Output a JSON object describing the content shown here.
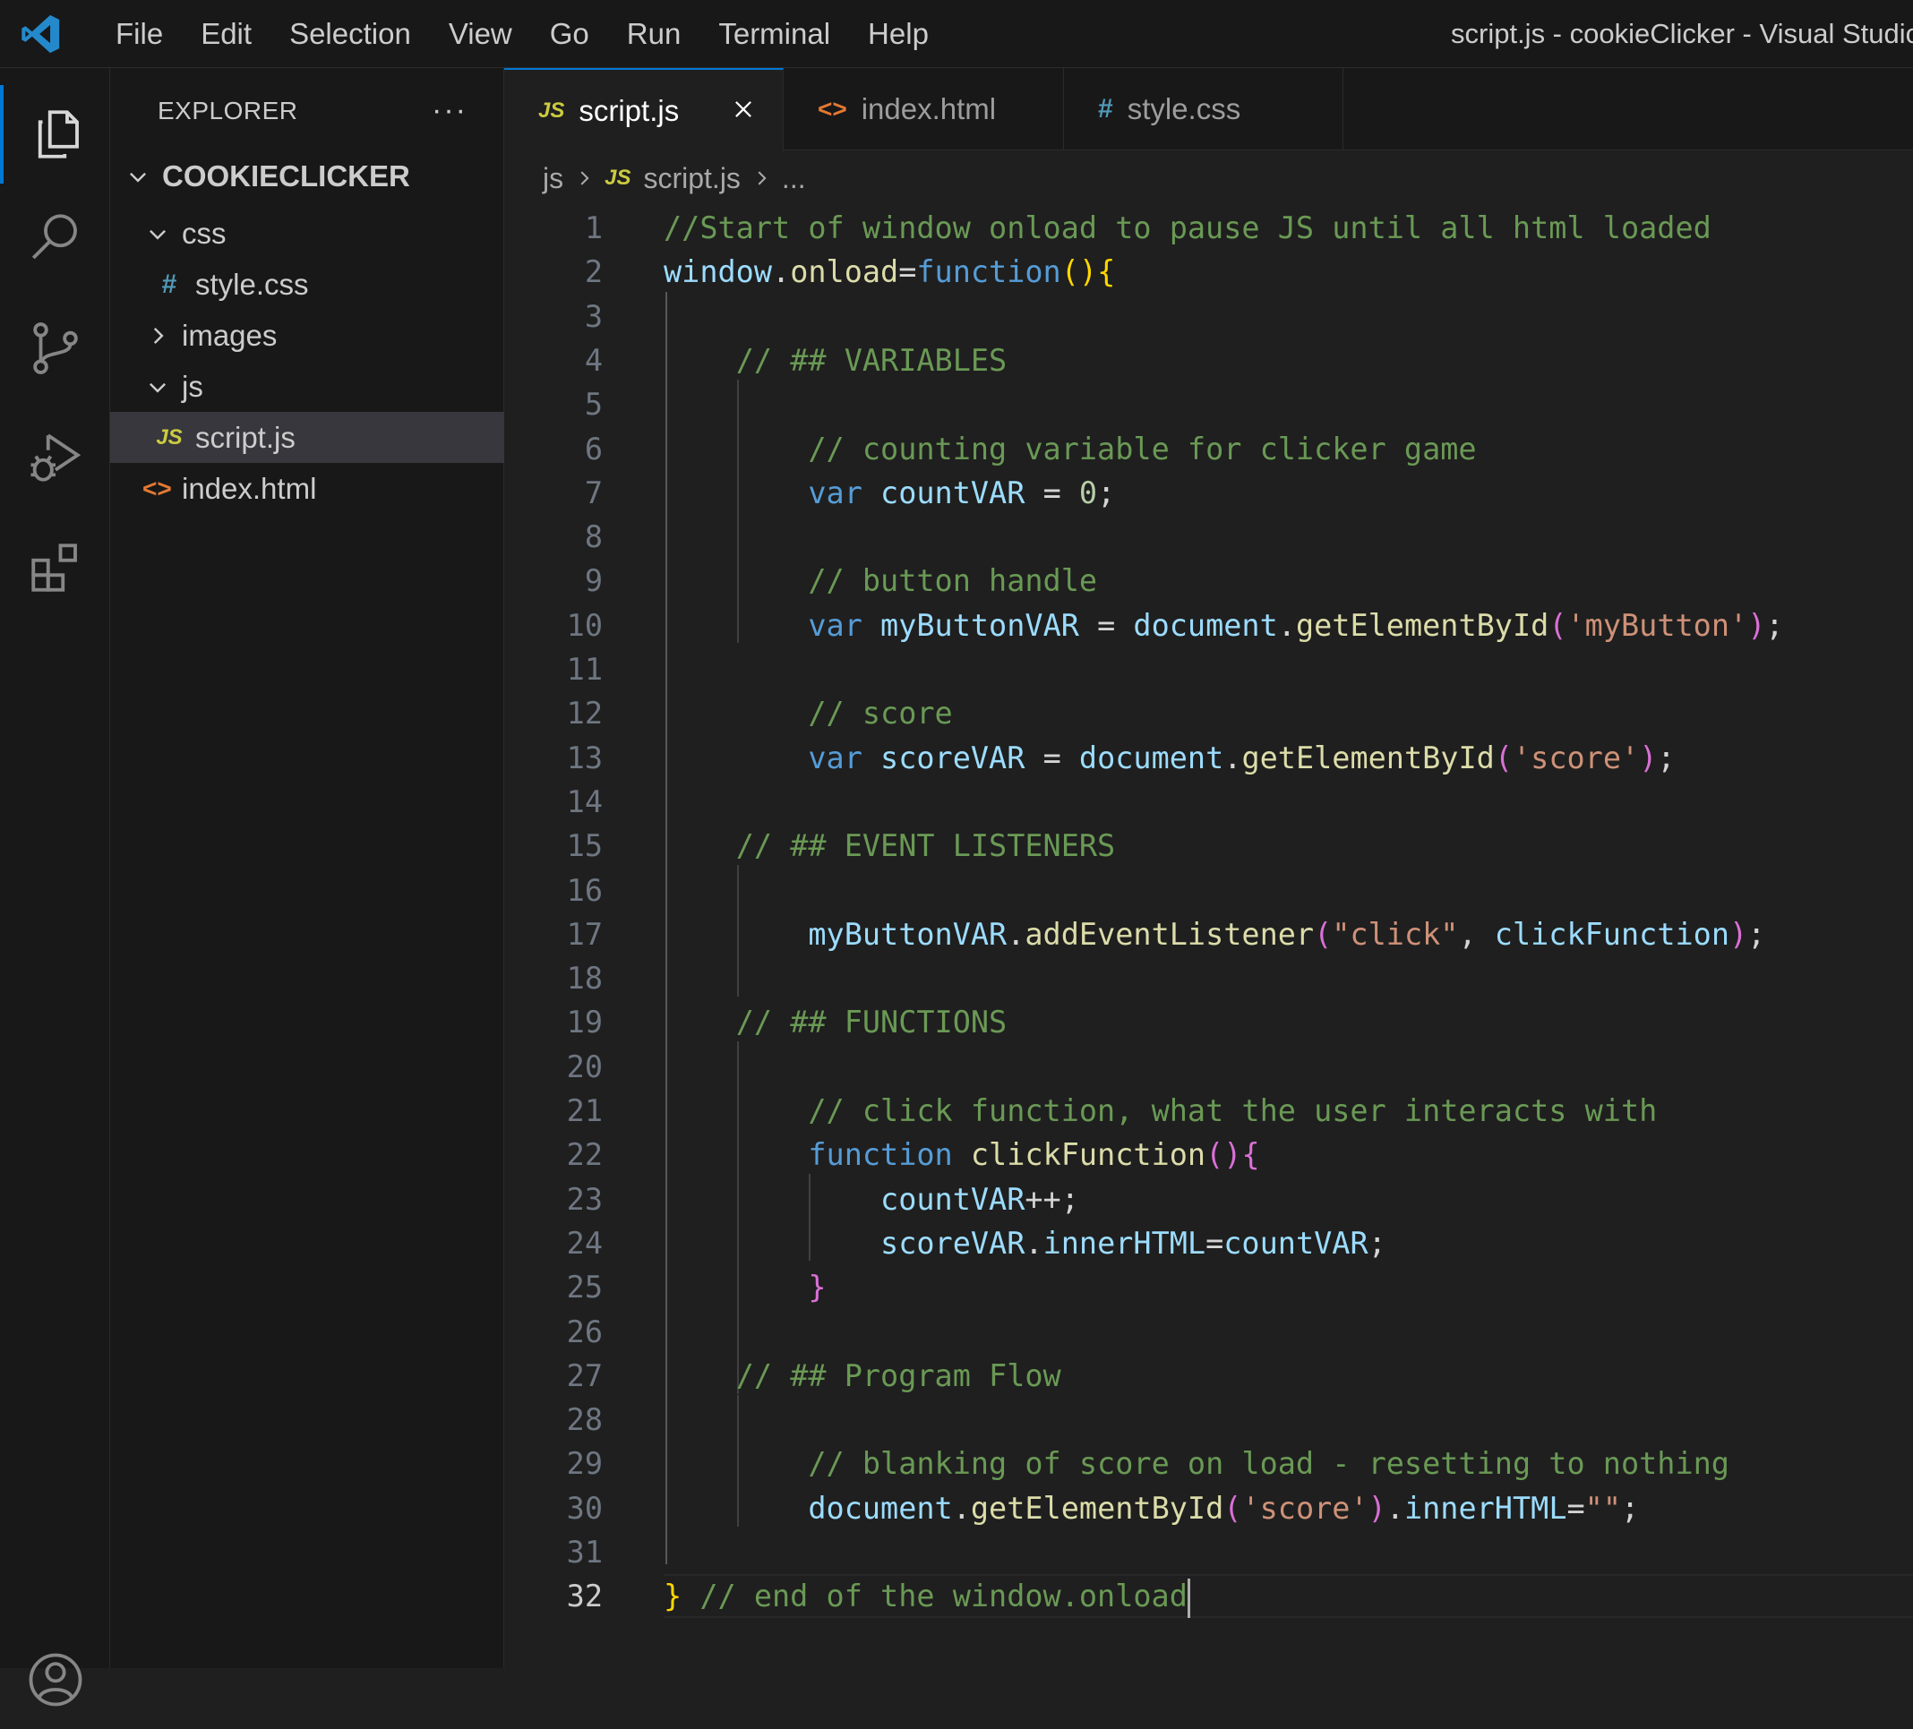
{
  "menu": [
    "File",
    "Edit",
    "Selection",
    "View",
    "Go",
    "Run",
    "Terminal",
    "Help"
  ],
  "window_title": "script.js - cookieClicker - Visual Studio Code",
  "activity_bar": [
    {
      "name": "explorer-icon",
      "active": true
    },
    {
      "name": "search-icon",
      "active": false
    },
    {
      "name": "source-control-icon",
      "active": false
    },
    {
      "name": "run-debug-icon",
      "active": false
    },
    {
      "name": "extensions-icon",
      "active": false
    },
    {
      "name": "accounts-icon",
      "active": false
    }
  ],
  "sidebar": {
    "title": "EXPLORER",
    "more": "···",
    "project": "COOKIECLICKER",
    "tree": [
      {
        "label": "css",
        "type": "folder",
        "expanded": true
      },
      {
        "label": "style.css",
        "type": "css"
      },
      {
        "label": "images",
        "type": "folder",
        "expanded": false
      },
      {
        "label": "js",
        "type": "folder",
        "expanded": true
      },
      {
        "label": "script.js",
        "type": "js",
        "selected": true
      },
      {
        "label": "index.html",
        "type": "html"
      }
    ]
  },
  "tabs": [
    {
      "label": "script.js",
      "icon": "JS",
      "active": true
    },
    {
      "label": "index.html",
      "icon": "<>",
      "active": false
    },
    {
      "label": "style.css",
      "icon": "#",
      "active": false
    }
  ],
  "breadcrumb": {
    "folder": "js",
    "file_icon": "JS",
    "file": "script.js",
    "more": "..."
  },
  "editor": {
    "current_line": 32,
    "lines": [
      [
        [
          "c-com",
          "//Start of window onload to pause JS until all html loaded"
        ]
      ],
      [
        [
          "c-var",
          "window"
        ],
        [
          "c-op",
          "."
        ],
        [
          "c-fn",
          "onload"
        ],
        [
          "c-op",
          "="
        ],
        [
          "c-kw",
          "function"
        ],
        [
          "b1",
          "()"
        ],
        [
          "b1",
          "{"
        ]
      ],
      [],
      [
        [
          "",
          "    "
        ],
        [
          "c-com",
          "// ## VARIABLES"
        ]
      ],
      [],
      [
        [
          "",
          "        "
        ],
        [
          "c-com",
          "// counting variable for clicker game"
        ]
      ],
      [
        [
          "",
          "        "
        ],
        [
          "c-kw",
          "var"
        ],
        [
          "c-op",
          " "
        ],
        [
          "c-var",
          "countVAR"
        ],
        [
          "c-op",
          " = "
        ],
        [
          "c-num",
          "0"
        ],
        [
          "c-op",
          ";"
        ]
      ],
      [],
      [
        [
          "",
          "        "
        ],
        [
          "c-com",
          "// button handle"
        ]
      ],
      [
        [
          "",
          "        "
        ],
        [
          "c-kw",
          "var"
        ],
        [
          "c-op",
          " "
        ],
        [
          "c-var",
          "myButtonVAR"
        ],
        [
          "c-op",
          " = "
        ],
        [
          "c-var",
          "document"
        ],
        [
          "c-op",
          "."
        ],
        [
          "c-fn",
          "getElementById"
        ],
        [
          "b2",
          "("
        ],
        [
          "c-str",
          "'myButton'"
        ],
        [
          "b2",
          ")"
        ],
        [
          "c-op",
          ";"
        ]
      ],
      [],
      [
        [
          "",
          "        "
        ],
        [
          "c-com",
          "// score"
        ]
      ],
      [
        [
          "",
          "        "
        ],
        [
          "c-kw",
          "var"
        ],
        [
          "c-op",
          " "
        ],
        [
          "c-var",
          "scoreVAR"
        ],
        [
          "c-op",
          " = "
        ],
        [
          "c-var",
          "document"
        ],
        [
          "c-op",
          "."
        ],
        [
          "c-fn",
          "getElementById"
        ],
        [
          "b2",
          "("
        ],
        [
          "c-str",
          "'score'"
        ],
        [
          "b2",
          ")"
        ],
        [
          "c-op",
          ";"
        ]
      ],
      [],
      [
        [
          "",
          "    "
        ],
        [
          "c-com",
          "// ## EVENT LISTENERS"
        ]
      ],
      [],
      [
        [
          "",
          "        "
        ],
        [
          "c-var",
          "myButtonVAR"
        ],
        [
          "c-op",
          "."
        ],
        [
          "c-fn",
          "addEventListener"
        ],
        [
          "b2",
          "("
        ],
        [
          "c-str",
          "\"click\""
        ],
        [
          "c-op",
          ", "
        ],
        [
          "c-var",
          "clickFunction"
        ],
        [
          "b2",
          ")"
        ],
        [
          "c-op",
          ";"
        ]
      ],
      [],
      [
        [
          "",
          "    "
        ],
        [
          "c-com",
          "// ## FUNCTIONS"
        ]
      ],
      [],
      [
        [
          "",
          "        "
        ],
        [
          "c-com",
          "// click function, what the user interacts with"
        ]
      ],
      [
        [
          "",
          "        "
        ],
        [
          "c-kw",
          "function"
        ],
        [
          "c-op",
          " "
        ],
        [
          "c-fn",
          "clickFunction"
        ],
        [
          "b2",
          "()"
        ],
        [
          "b2",
          "{"
        ]
      ],
      [
        [
          "",
          "            "
        ],
        [
          "c-var",
          "countVAR"
        ],
        [
          "c-op",
          "++;"
        ]
      ],
      [
        [
          "",
          "            "
        ],
        [
          "c-var",
          "scoreVAR"
        ],
        [
          "c-op",
          "."
        ],
        [
          "c-var",
          "innerHTML"
        ],
        [
          "c-op",
          "="
        ],
        [
          "c-var",
          "countVAR"
        ],
        [
          "c-op",
          ";"
        ]
      ],
      [
        [
          "",
          "        "
        ],
        [
          "b2",
          "}"
        ]
      ],
      [],
      [
        [
          "",
          "    "
        ],
        [
          "c-com",
          "// ## Program Flow"
        ]
      ],
      [],
      [
        [
          "",
          "        "
        ],
        [
          "c-com",
          "// blanking of score on load - resetting to nothing"
        ]
      ],
      [
        [
          "",
          "        "
        ],
        [
          "c-var",
          "document"
        ],
        [
          "c-op",
          "."
        ],
        [
          "c-fn",
          "getElementById"
        ],
        [
          "b2",
          "("
        ],
        [
          "c-str",
          "'score'"
        ],
        [
          "b2",
          ")"
        ],
        [
          "c-op",
          "."
        ],
        [
          "c-var",
          "innerHTML"
        ],
        [
          "c-op",
          "="
        ],
        [
          "c-str",
          "\"\""
        ],
        [
          "c-op",
          ";"
        ]
      ],
      [],
      [
        [
          "b1",
          "}"
        ],
        [
          "c-op",
          " "
        ],
        [
          "c-com",
          "// end of the window.onload"
        ]
      ]
    ]
  }
}
